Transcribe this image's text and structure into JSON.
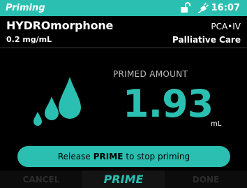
{
  "status_bar": {
    "title": "Priming",
    "time": "16:07",
    "icons": [
      "unlocked-lock-icon",
      "power-plug-icon"
    ]
  },
  "header": {
    "drug_name": "HYDROmorphone",
    "concentration": "0.2 mg/mL",
    "mode": "PCA•IV",
    "care_area": "Palliative Care"
  },
  "primed": {
    "label": "PRIMED AMOUNT",
    "value": "1.93",
    "unit": "mL",
    "icon": "droplets-icon"
  },
  "prompt": {
    "prefix": "Release",
    "key": "PRIME",
    "suffix": "to stop priming"
  },
  "softkeys": {
    "left": "CANCEL",
    "center": "PRIME",
    "right": "DONE"
  },
  "colors": {
    "accent": "#2abfb0",
    "background": "#000000",
    "disabled": "#2c2c2c"
  }
}
